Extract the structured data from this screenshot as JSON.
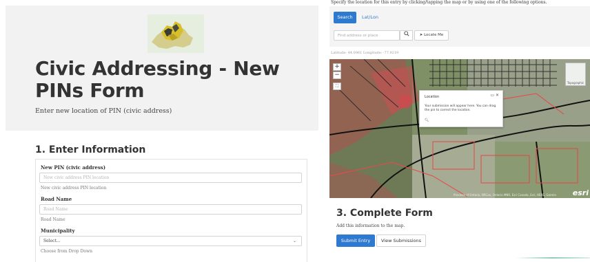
{
  "header": {
    "title": "Civic Addressing - New PINs Form",
    "subtitle": "Enter new location of PIN (civic address)"
  },
  "section1": {
    "title": "1. Enter Information",
    "fields": [
      {
        "label": "New PIN (civic address)",
        "placeholder": "New civic address PIN location",
        "help": "New civic address PIN location"
      },
      {
        "label": "Road Name",
        "placeholder": "Road Name",
        "help": "Road Name"
      },
      {
        "label": "Municipality",
        "selected": "Select...",
        "help": "Choose from Drop Down"
      }
    ]
  },
  "location": {
    "instruction": "Specify the location for this entry by clicking/tapping the map or by using one of the following options.",
    "tabs": {
      "search": "Search",
      "latlon": "Lat/Lon"
    },
    "search_placeholder": "Find address or place",
    "locate_label": "Locate Me",
    "latlong_readout": "Latitude: 44.0961 Longitude: -77.9219"
  },
  "map": {
    "zoom_in": "+",
    "zoom_out": "−",
    "basemap_label": "Topographic",
    "popup": {
      "title": "Location",
      "text": "Your submission will appear here. You can drag the pin to correct the location."
    },
    "attribution": "Province of Ontario, NRCan, Ontario MNR, Esri Canada, Esri, HERE, Garmin",
    "esri_logo": "esri"
  },
  "section3": {
    "title": "3. Complete Form",
    "subtitle": "Add this information to the map.",
    "submit_label": "Submit Entry",
    "view_label": "View Submissions"
  },
  "colors": {
    "primary": "#2e7ad1",
    "hero_bg": "#f2f2f2"
  }
}
